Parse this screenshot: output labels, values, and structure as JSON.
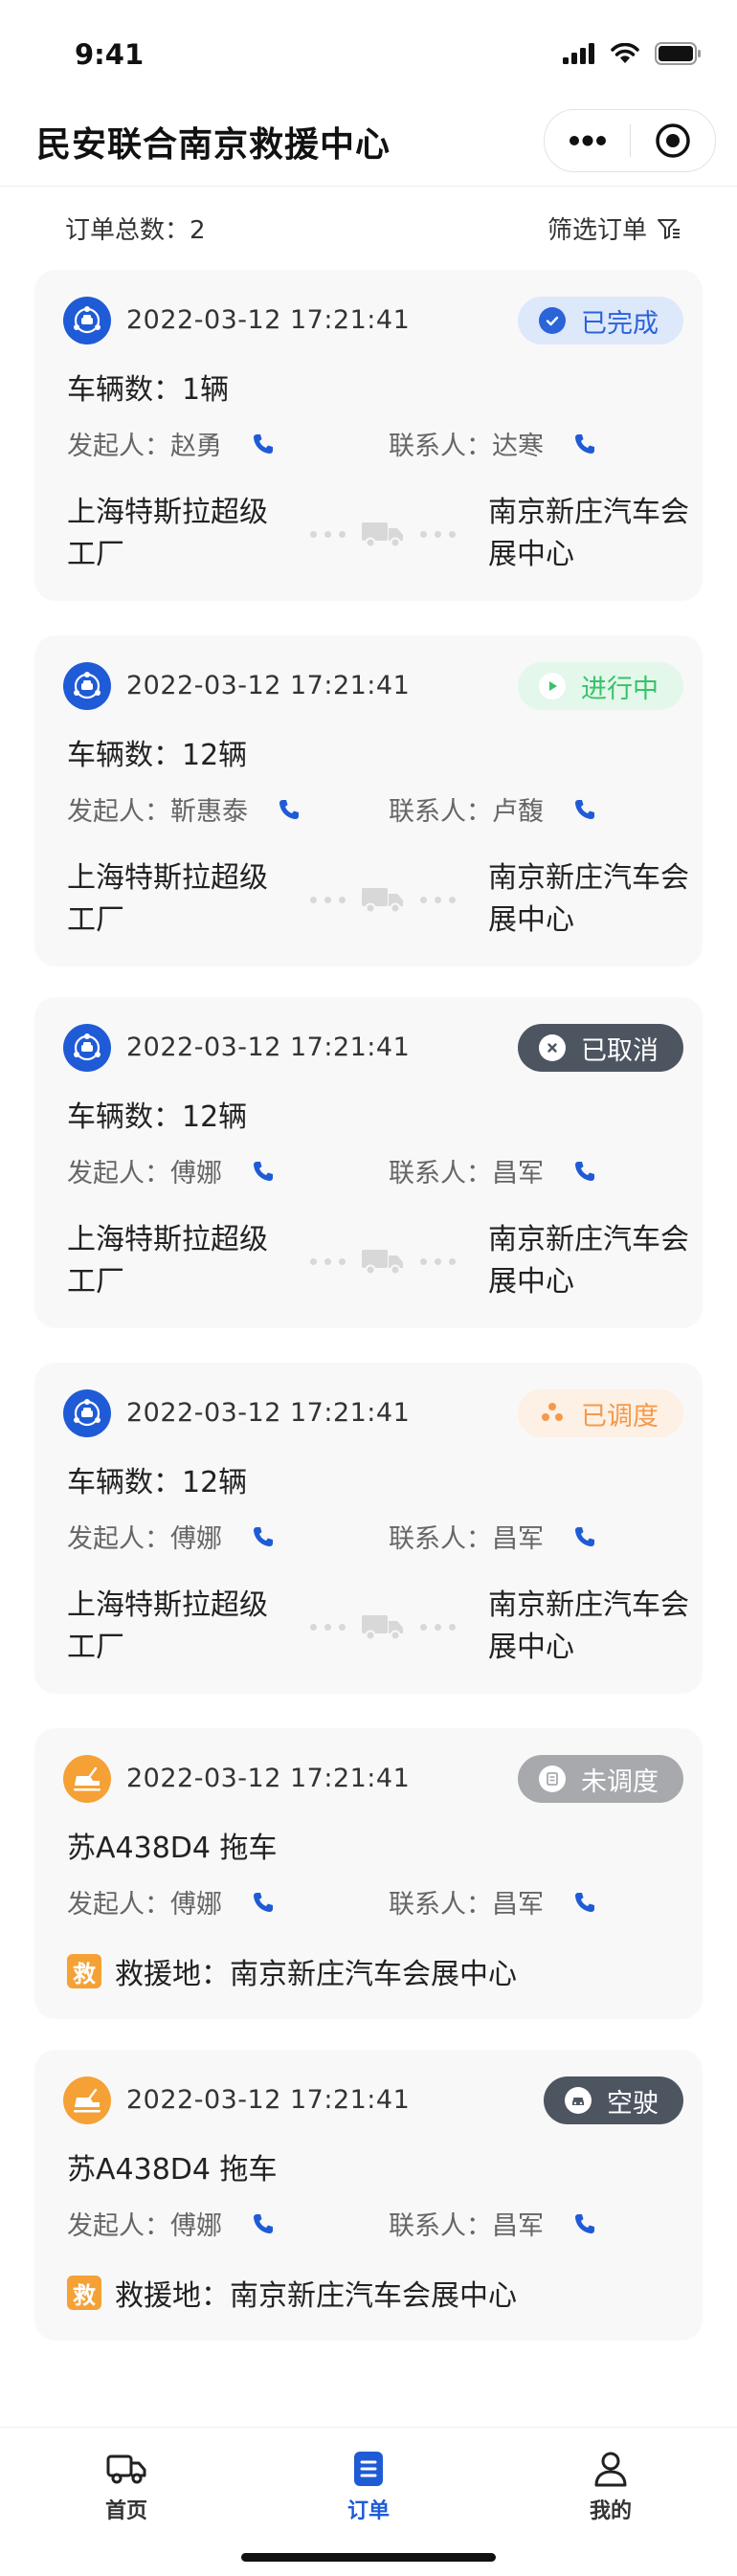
{
  "status_bar": {
    "time": "9:41"
  },
  "title_bar": {
    "title": "民安联合南京救援中心"
  },
  "summary": {
    "total_label": "订单总数：2",
    "filter_label": "筛选订单"
  },
  "colors": {
    "primary": "#1f5bd6",
    "orange": "#f5a135",
    "done_bg": "#dde8fb",
    "doing_fg": "#39c26a",
    "dark_badge": "#4d5561"
  },
  "labels": {
    "initiator": "发起人：",
    "contact": "联系人：",
    "rescue_place": "救援地：",
    "rescue_tag": "救"
  },
  "orders": [
    {
      "time": "2022-03-12  17:21:41",
      "status": "已完成",
      "vehicles": "车辆数：1辆",
      "initiator": "赵勇",
      "contact": "达寒",
      "from": "上海特斯拉超级工厂",
      "to": "南京新庄汽车会展中心"
    },
    {
      "time": "2022-03-12  17:21:41",
      "status": "进行中",
      "vehicles": "车辆数：12辆",
      "initiator": "靳惠泰",
      "contact": "卢馥",
      "from": "上海特斯拉超级工厂",
      "to": "南京新庄汽车会展中心"
    },
    {
      "time": "2022-03-12  17:21:41",
      "status": "已取消",
      "vehicles": "车辆数：12辆",
      "initiator": "傅娜",
      "contact": "昌军",
      "from": "上海特斯拉超级工厂",
      "to": "南京新庄汽车会展中心"
    },
    {
      "time": "2022-03-12  17:21:41",
      "status": "已调度",
      "vehicles": "车辆数：12辆",
      "initiator": "傅娜",
      "contact": "昌军",
      "from": "上海特斯拉超级工厂",
      "to": "南京新庄汽车会展中心"
    },
    {
      "time": "2022-03-12  17:21:41",
      "status": "未调度",
      "vehicles": "苏A438D4   拖车",
      "initiator": "傅娜",
      "contact": "昌军",
      "rescue_place": "南京新庄汽车会展中心"
    },
    {
      "time": "2022-03-12  17:21:41",
      "status": "空驶",
      "vehicles": "苏A438D4   拖车",
      "initiator": "傅娜",
      "contact": "昌军",
      "rescue_place": "南京新庄汽车会展中心"
    }
  ],
  "tab_bar": {
    "tabs": [
      {
        "label": "首页"
      },
      {
        "label": "订单"
      },
      {
        "label": "我的"
      }
    ],
    "active": "订单"
  }
}
